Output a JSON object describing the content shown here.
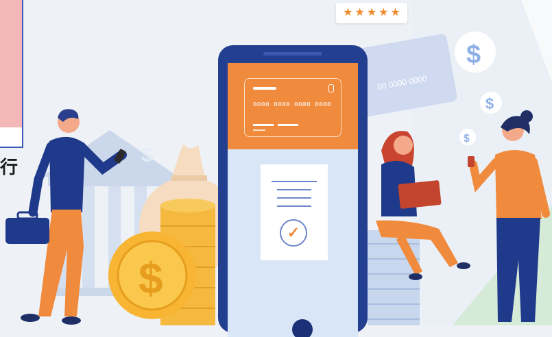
{
  "left_panel": {
    "text": "行"
  },
  "rating": {
    "stars": [
      "★",
      "★",
      "★",
      "★",
      "★"
    ],
    "color": "#f08a2c"
  },
  "card": {
    "number_top": "0000 0000 0000 0000",
    "number_back": "00 0000 0000"
  },
  "dollar_sign": "$",
  "icons": [
    "dollar-icon",
    "check-icon",
    "bank-icon",
    "money-bag-icon",
    "coin-icon",
    "laptop-icon",
    "briefcase-icon",
    "phone-icon"
  ],
  "colors": {
    "accent": "#f08a3c",
    "navy": "#233f8f",
    "light_blue": "#d9e6f7"
  }
}
